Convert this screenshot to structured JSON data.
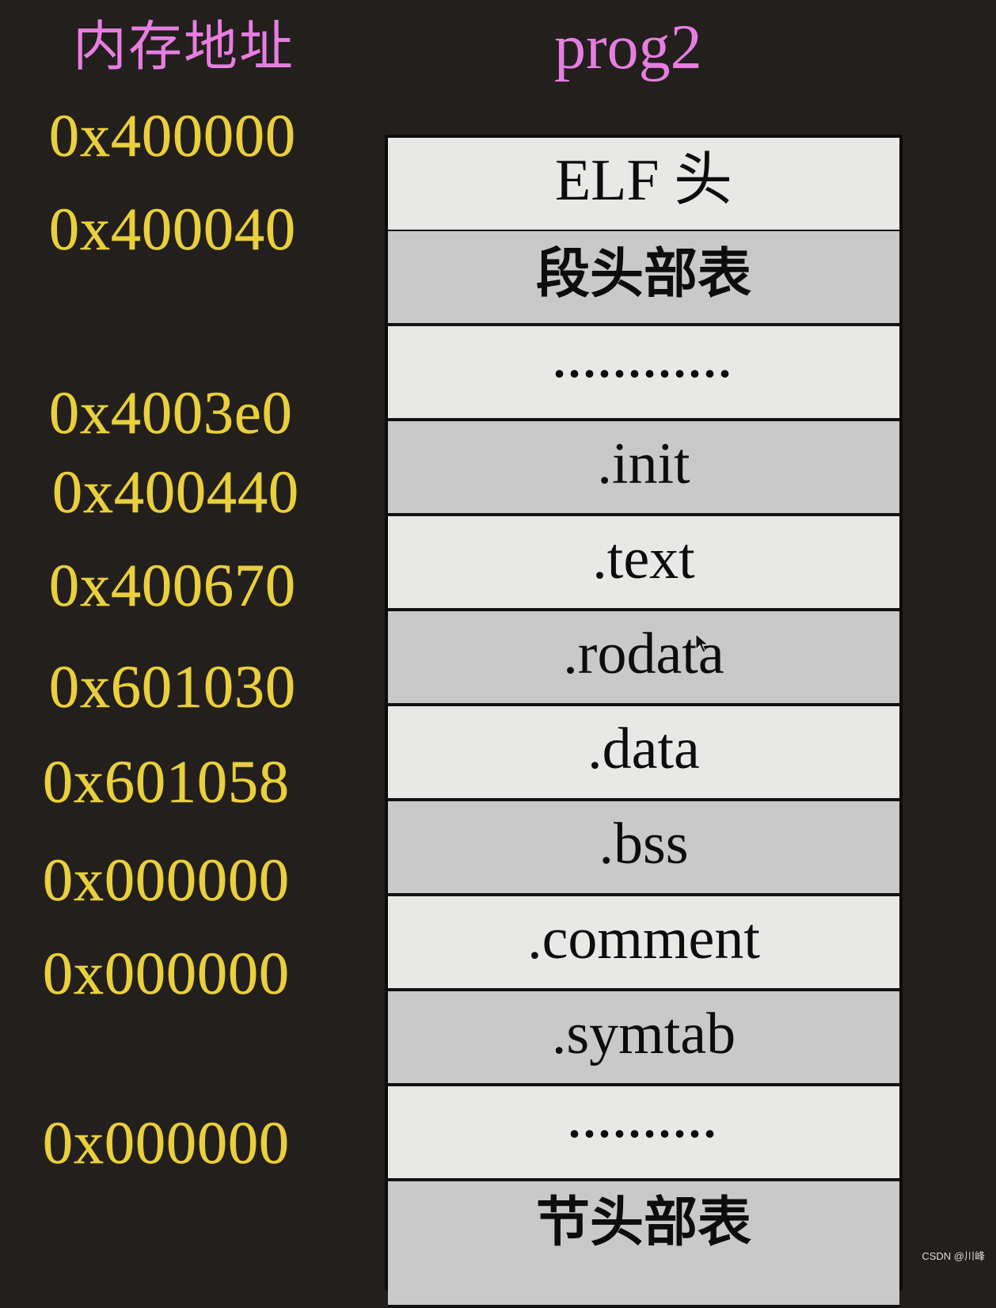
{
  "headers": {
    "address_column": "内存地址",
    "program_name": "prog2"
  },
  "colors": {
    "background": "#231f1d",
    "header_text": "#e67ee0",
    "address_text": "#e9cf3c",
    "row_light": "#e8e8e6",
    "row_dark": "#c9c9c9",
    "border": "#0c0c0c"
  },
  "addresses": [
    "0x400000",
    "0x400040",
    "0x4003e0",
    "0x400440",
    "0x400670",
    "0x601030",
    "0x601058",
    "0x000000",
    "0x000000",
    "0x000000"
  ],
  "sections": [
    {
      "label": "ELF 头",
      "shade": "light"
    },
    {
      "label": "段头部表",
      "shade": "dark"
    },
    {
      "label": "............",
      "shade": "light"
    },
    {
      "label": ".init",
      "shade": "dark"
    },
    {
      "label": ".text",
      "shade": "light"
    },
    {
      "label": ".rodata",
      "shade": "dark"
    },
    {
      "label": ".data",
      "shade": "light"
    },
    {
      "label": ".bss",
      "shade": "dark"
    },
    {
      "label": ".comment",
      "shade": "light"
    },
    {
      "label": ".symtab",
      "shade": "dark"
    },
    {
      "label": "..........",
      "shade": "light"
    },
    {
      "label": "节头部表",
      "shade": "dark"
    }
  ],
  "watermark": "CSDN @川峰"
}
